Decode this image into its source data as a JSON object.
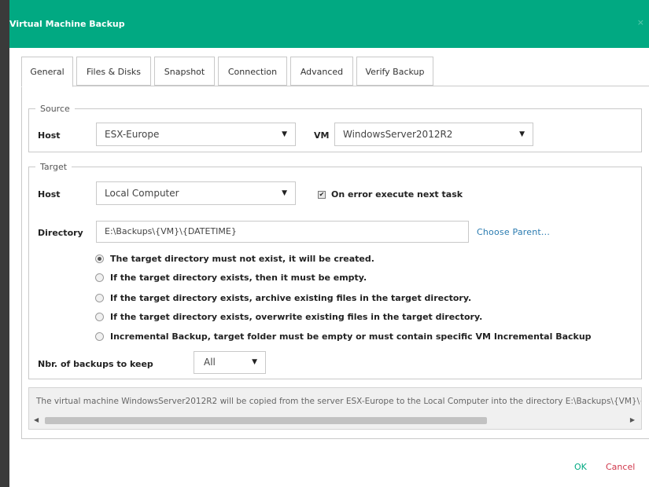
{
  "window": {
    "title": "Virtual Machine Backup",
    "close_glyph": "×",
    "accent_color": "#01a982"
  },
  "tabs": [
    {
      "label": "General",
      "active": true
    },
    {
      "label": "Files & Disks"
    },
    {
      "label": "Snapshot"
    },
    {
      "label": "Connection"
    },
    {
      "label": "Advanced"
    },
    {
      "label": "Verify Backup"
    }
  ],
  "source": {
    "legend": "Source",
    "host_label": "Host",
    "host_value": "ESX-Europe",
    "vm_label": "VM",
    "vm_value": "WindowsServer2012R2"
  },
  "target": {
    "legend": "Target",
    "host_label": "Host",
    "host_value": "Local Computer",
    "on_error_label": "On error execute next task",
    "on_error_checked": true,
    "directory_label": "Directory",
    "directory_value": "E:\\Backups\\{VM}\\{DATETIME}",
    "choose_parent_label": "Choose Parent...",
    "options": [
      {
        "label": "The target directory must not exist, it will be created.",
        "selected": true
      },
      {
        "label": "If the target directory exists, then it must be empty.",
        "selected": false
      },
      {
        "label": "If the target directory exists, archive existing files in the target directory.",
        "selected": false
      },
      {
        "label": "If the target directory exists, overwrite existing files in the target directory.",
        "selected": false
      },
      {
        "label": "Incremental Backup, target folder must be empty or must contain specific VM Incremental Backup",
        "selected": false
      }
    ],
    "keep_label": "Nbr. of backups to keep",
    "keep_value": "All"
  },
  "summary": {
    "text": "The virtual machine WindowsServer2012R2 will be copied from the server ESX-Europe to the Local Computer into the directory E:\\Backups\\{VM}\\{DATETIME}"
  },
  "footer": {
    "ok_label": "OK",
    "cancel_label": "Cancel"
  },
  "icons": {
    "caret": "▼",
    "check": "✔",
    "scroll_left": "◀",
    "scroll_right": "▶"
  }
}
